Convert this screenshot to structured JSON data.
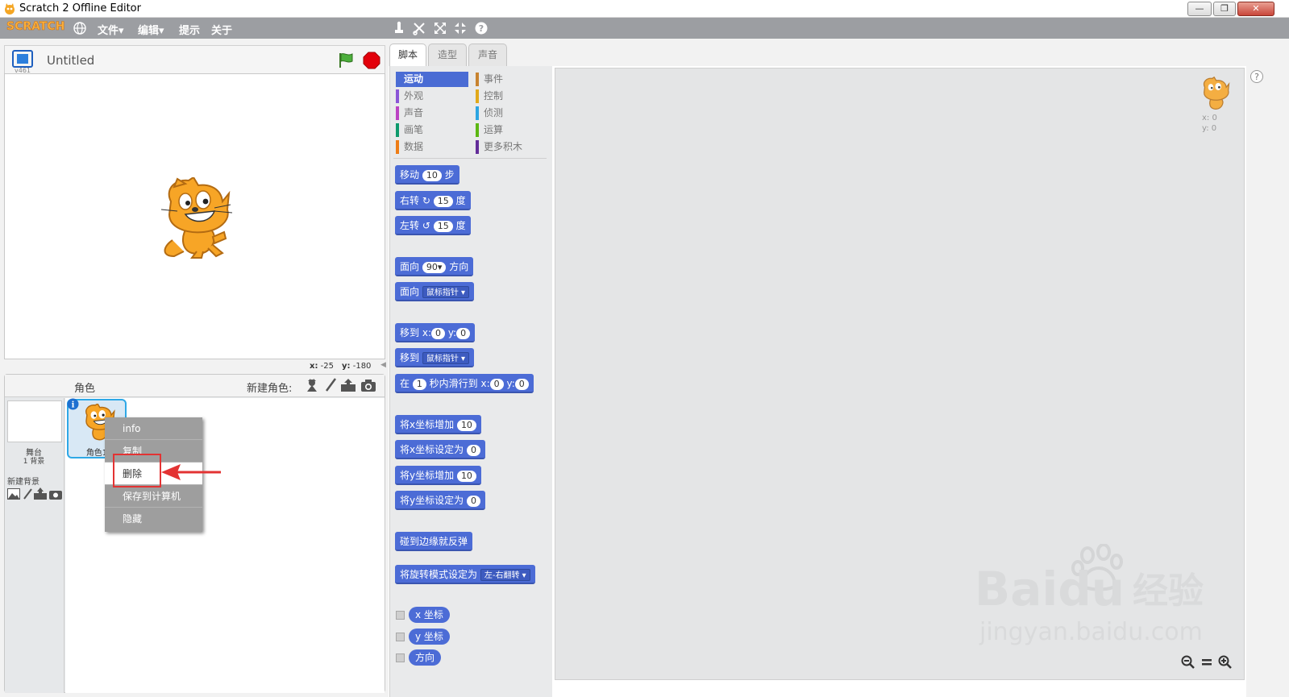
{
  "window": {
    "title": "Scratch 2 Offline Editor",
    "minimize": "—",
    "restore": "❐",
    "close": "✕"
  },
  "menubar": {
    "logo": "SCRATCH",
    "items": [
      "文件",
      "编辑",
      "提示",
      "关于"
    ],
    "dropdown_marker": "▾"
  },
  "stage": {
    "title": "Untitled",
    "version": "v461",
    "mouse_x_label": "x:",
    "mouse_x": "-25",
    "mouse_y_label": "y:",
    "mouse_y": "-180"
  },
  "sprites": {
    "heading": "角色",
    "new_sprite_label": "新建角色:",
    "stage_thumb_label": "舞台",
    "backdrop_count": "1 背景",
    "new_backdrop_label": "新建背景",
    "sprite_name": "角色1"
  },
  "context_menu": {
    "items": [
      "info",
      "复制",
      "删除",
      "保存到计算机",
      "隐藏"
    ],
    "highlighted": "删除"
  },
  "tabs": [
    "脚本",
    "造型",
    "声音"
  ],
  "categories": {
    "left": [
      {
        "label": "运动",
        "color": "#4a6cd4"
      },
      {
        "label": "外观",
        "color": "#8a55d7"
      },
      {
        "label": "声音",
        "color": "#bb42c3"
      },
      {
        "label": "画笔",
        "color": "#0e9a6c"
      },
      {
        "label": "数据",
        "color": "#ee7d16"
      }
    ],
    "right": [
      {
        "label": "事件",
        "color": "#c88330"
      },
      {
        "label": "控制",
        "color": "#e1a91a"
      },
      {
        "label": "侦测",
        "color": "#2ca5e2"
      },
      {
        "label": "运算",
        "color": "#5cb712"
      },
      {
        "label": "更多积木",
        "color": "#632d99"
      }
    ]
  },
  "blocks": {
    "move": {
      "text": "移动",
      "value": "10",
      "unit": "步"
    },
    "turn_right": {
      "text": "右转",
      "value": "15",
      "unit": "度"
    },
    "turn_left": {
      "text": "左转",
      "value": "15",
      "unit": "度"
    },
    "point_dir": {
      "text": "面向",
      "value": "90",
      "unit": "方向"
    },
    "point_towards": {
      "text": "面向",
      "option": "鼠标指针"
    },
    "goto_xy": {
      "text": "移到",
      "x_label": "x:",
      "x": "0",
      "y_label": "y:",
      "y": "0"
    },
    "goto": {
      "text": "移到",
      "option": "鼠标指针"
    },
    "glide": {
      "prefix": "在",
      "secs": "1",
      "mid": "秒内滑行到",
      "x_label": "x:",
      "x": "0",
      "y_label": "y:",
      "y": "0"
    },
    "change_x": {
      "text": "将x坐标增加",
      "value": "10"
    },
    "set_x": {
      "text": "将x坐标设定为",
      "value": "0"
    },
    "change_y": {
      "text": "将y坐标增加",
      "value": "10"
    },
    "set_y": {
      "text": "将y坐标设定为",
      "value": "0"
    },
    "bounce": {
      "text": "碰到边缘就反弹"
    },
    "rotation_style": {
      "text": "将旋转模式设定为",
      "option": "左-右翻转"
    },
    "reporters": [
      "x 坐标",
      "y 坐标",
      "方向"
    ]
  },
  "scripts_area": {
    "x_label": "x:",
    "x": "0",
    "y_label": "y:",
    "y": "0"
  },
  "watermark": {
    "brand": "Bai",
    "brand2": "du",
    "cn": "经验",
    "url": "jingyan.baidu.com"
  },
  "colors": {
    "menubar": "#9c9ea2",
    "motion": "#4c6cd6",
    "highlight_box": "#e33333"
  }
}
